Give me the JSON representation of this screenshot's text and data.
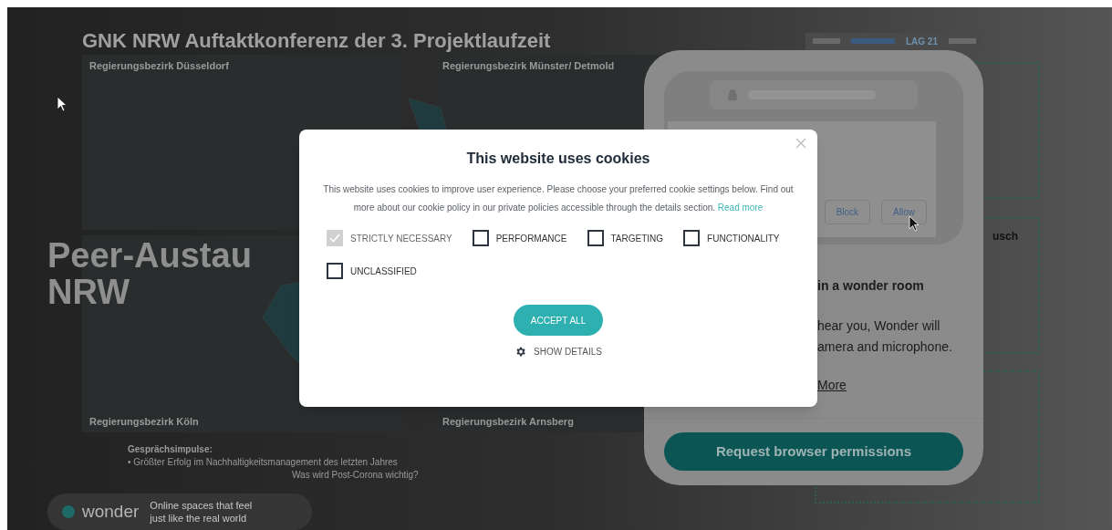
{
  "slide": {
    "title": "GNK NRW Auftaktkonferenz der 3. Projektlaufzeit",
    "regions": [
      "Regierungsbezirk Düsseldorf",
      "Regierungsbezirk Münster/ Detmold",
      "Regierungsbezirk Köln",
      "Regierungsbezirk Arnsberg"
    ],
    "headline": [
      "Peer-Austau",
      "NRW"
    ],
    "prompts": {
      "heading": "Gesprächsimpulse:",
      "items": [
        "• Größter Erfolg im Nachhaltigkeitsmanagement des letzten Jahres",
        "Was wird Post-Corona wichtig?"
      ]
    },
    "partial_label": "usch",
    "logo_text": "LAG 21"
  },
  "wonder_badge": {
    "brand": "wonder",
    "tagline": [
      "Online spaces that feel",
      "just like the real world"
    ]
  },
  "permission_card": {
    "buttons": [
      "Block",
      "Allow"
    ],
    "heading": "in a wonder room",
    "body": [
      "hear you, Wonder will",
      "amera and microphone."
    ],
    "link": "More",
    "action": "Request browser permissions"
  },
  "cookie_dialog": {
    "title": "This website uses cookies",
    "text": "This website uses cookies to improve user experience. Please choose your preferred cookie settings below. Find out more about our cookie policy in our private policies accessible through the details section.",
    "link": "Read more",
    "options": [
      {
        "label": "STRICTLY NECESSARY",
        "checked": true,
        "disabled": true
      },
      {
        "label": "PERFORMANCE",
        "checked": false,
        "disabled": false
      },
      {
        "label": "TARGETING",
        "checked": false,
        "disabled": false
      },
      {
        "label": "FUNCTIONALITY",
        "checked": false,
        "disabled": false
      },
      {
        "label": "UNCLASSIFIED",
        "checked": false,
        "disabled": false
      }
    ],
    "accept": "ACCEPT ALL",
    "details": "SHOW DETAILS"
  }
}
